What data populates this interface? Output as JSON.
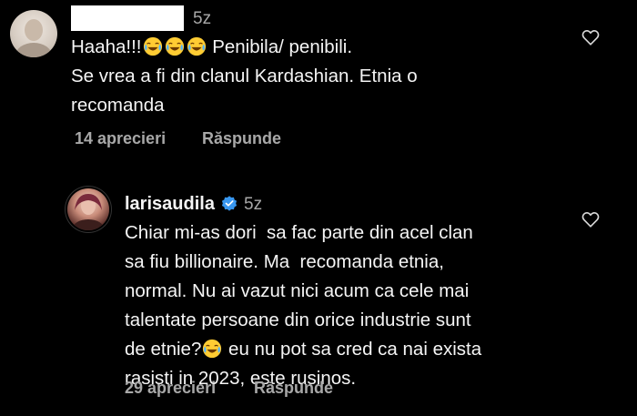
{
  "comments": [
    {
      "username_redacted": true,
      "time": "5z",
      "line1_pre": "Haaha!!!",
      "line1_post": " Penibila/ penibili.",
      "line2": "Se vrea a fi din clanul Kardashian. Etnia o",
      "line3": "recomanda",
      "likes": "14 aprecieri",
      "reply": "Răspunde",
      "emoji_icon": "face-with-tears-of-joy",
      "heart_icon": "heart-outline"
    },
    {
      "username": "larisaudila",
      "verified_icon": "verified-badge",
      "time": "5z",
      "line1": "Chiar mi-as dori  sa fac parte din acel clan",
      "line2": "sa fiu billionaire. Ma  recomanda etnia,",
      "line3": "normal. Nu ai vazut nici acum ca cele mai",
      "line4": "talentate persoane din orice industrie sunt",
      "line5_pre": "de etnie?",
      "line5_post": " eu nu pot sa cred ca nai exista",
      "line6": "rasisti in 2023, este rusinos.",
      "likes": "29 aprecieri",
      "reply": "Răspunde",
      "emoji_icon": "face-with-tears-of-joy",
      "heart_icon": "heart-outline"
    }
  ],
  "colors": {
    "background": "#000000",
    "text": "#f5f5f5",
    "secondary": "#a8a8a8",
    "verified": "#3897f0"
  }
}
